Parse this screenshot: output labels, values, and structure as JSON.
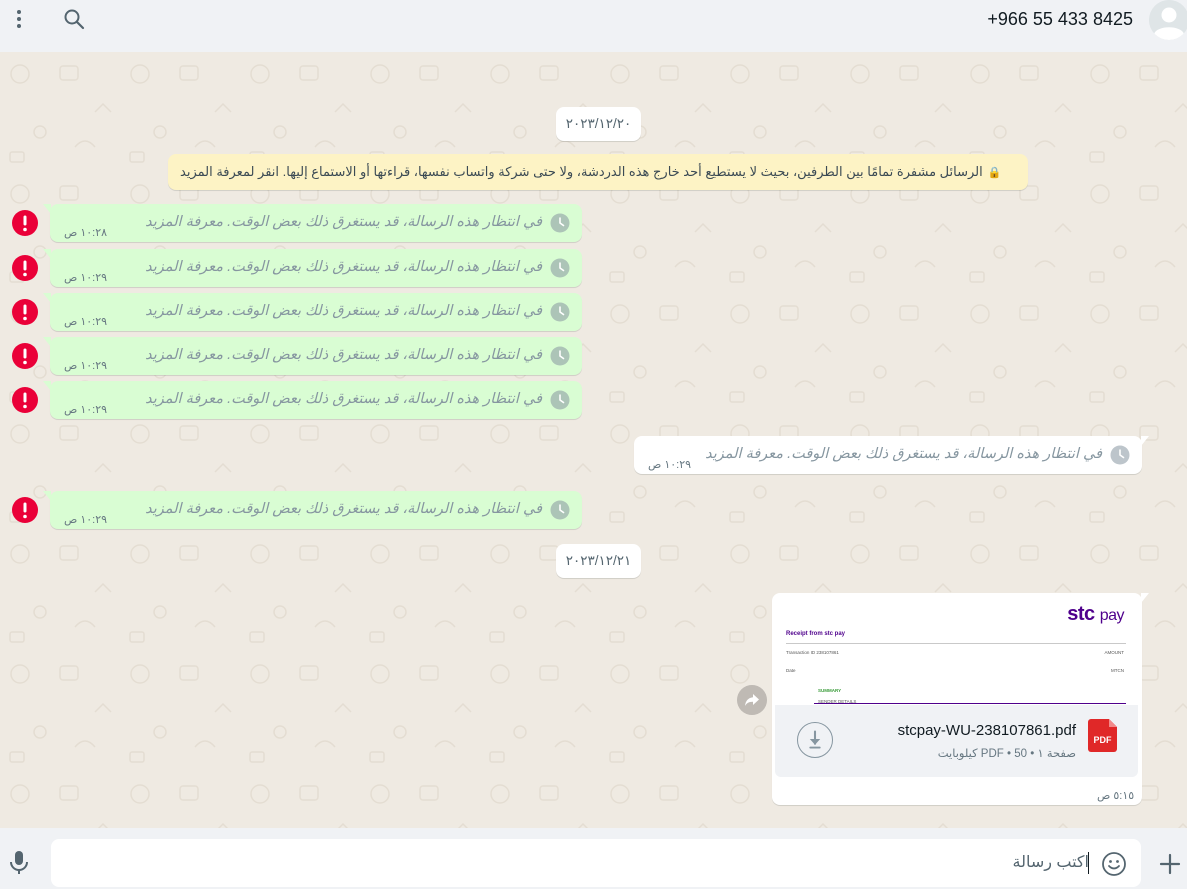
{
  "header": {
    "contact_name": "+966 55 433 8425"
  },
  "chat": {
    "date_1": "٢٠٢٣/١٢/٢٠",
    "date_2": "٢٠٢٣/١٢/٢١",
    "encryption_notice": "الرسائل مشفرة تمامًا بين الطرفين، بحيث لا يستطيع أحد خارج هذه الدردشة، ولا حتى شركة واتساب نفسها، قراءتها أو الاستماع إليها. انقر لمعرفة المزيد",
    "messages": [
      {
        "text": "في انتظار هذه الرسالة، قد يستغرق ذلك بعض الوقت. معرفة المزيد",
        "time": "١٠:٢٨ ص"
      },
      {
        "text": "في انتظار هذه الرسالة، قد يستغرق ذلك بعض الوقت. معرفة المزيد",
        "time": "١٠:٢٩ ص"
      },
      {
        "text": "في انتظار هذه الرسالة، قد يستغرق ذلك بعض الوقت. معرفة المزيد",
        "time": "١٠:٢٩ ص"
      },
      {
        "text": "في انتظار هذه الرسالة، قد يستغرق ذلك بعض الوقت. معرفة المزيد",
        "time": "١٠:٢٩ ص"
      },
      {
        "text": "في انتظار هذه الرسالة، قد يستغرق ذلك بعض الوقت. معرفة المزيد",
        "time": "١٠:٢٩ ص"
      },
      {
        "text": "في انتظار هذه الرسالة، قد يستغرق ذلك بعض الوقت. معرفة المزيد",
        "time": "١٠:٢٩ ص"
      },
      {
        "text": "في انتظار هذه الرسالة، قد يستغرق ذلك بعض الوقت. معرفة المزيد",
        "time": "١٠:٢٩ ص"
      }
    ],
    "document": {
      "brand": "stc",
      "brand_suffix": "pay",
      "preview_heading": "Receipt from stc pay",
      "preview_transaction": "Transaction ID 238107861",
      "preview_amount": "AMOUNT",
      "preview_date": "Date",
      "preview_mtcn": "MTCN",
      "preview_summary": "SUMMARY",
      "preview_sender": "SENDER DETAILS",
      "file_name": "stcpay-WU-238107861.pdf",
      "meta": "صفحة ١ • PDF • 50 كيلوبايت",
      "pdf_label": "PDF",
      "time": "٥:١٥ ص"
    }
  },
  "composer": {
    "placeholder": "اكتب رسالة"
  },
  "colors": {
    "outgoing_bubble": "#d9fdd3",
    "incoming_bubble": "#ffffff",
    "error": "#ea0038",
    "notice_bg": "#fdf3c5",
    "brand_purple": "#4f008c",
    "pdf_red": "#e02828"
  },
  "icons": [
    "menu-icon",
    "search-icon",
    "avatar-icon",
    "clock-icon",
    "error-icon",
    "forward-icon",
    "download-icon",
    "pdf-icon",
    "mic-icon",
    "emoji-icon",
    "plus-icon",
    "lock-icon"
  ]
}
